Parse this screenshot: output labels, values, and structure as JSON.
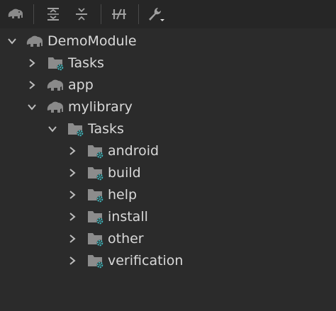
{
  "toolbar": {
    "buttons": [
      {
        "name": "elephant-icon",
        "label": "Gradle"
      },
      {
        "name": "expand-all-icon",
        "label": "Expand All"
      },
      {
        "name": "collapse-all-icon",
        "label": "Collapse All"
      },
      {
        "name": "toggle-offline-icon",
        "label": "Toggle Offline Mode"
      },
      {
        "name": "wrench-dropdown-icon",
        "label": "Build Tool Settings"
      }
    ]
  },
  "tree": {
    "items": [
      {
        "label": "DemoModule",
        "icon": "elephant-icon",
        "expanded": true,
        "level": 0
      },
      {
        "label": "Tasks",
        "icon": "task-folder-icon",
        "expanded": false,
        "level": 1
      },
      {
        "label": "app",
        "icon": "elephant-icon",
        "expanded": false,
        "level": 1
      },
      {
        "label": "mylibrary",
        "icon": "elephant-icon",
        "expanded": true,
        "level": 1
      },
      {
        "label": "Tasks",
        "icon": "task-folder-icon",
        "expanded": true,
        "level": 2
      },
      {
        "label": "android",
        "icon": "task-folder-icon",
        "expanded": false,
        "level": 3
      },
      {
        "label": "build",
        "icon": "task-folder-icon",
        "expanded": false,
        "level": 3
      },
      {
        "label": "help",
        "icon": "task-folder-icon",
        "expanded": false,
        "level": 3
      },
      {
        "label": "install",
        "icon": "task-folder-icon",
        "expanded": false,
        "level": 3
      },
      {
        "label": "other",
        "icon": "task-folder-icon",
        "expanded": false,
        "level": 3
      },
      {
        "label": "verification",
        "icon": "task-folder-icon",
        "expanded": false,
        "level": 3
      }
    ]
  },
  "colors": {
    "background": "#2b2b2b",
    "toolbar": "#262626",
    "text": "#d9d9d9",
    "icon_gray": "#8a8a8a",
    "folder": "#8c8c8c",
    "gear": "#3fb0b5"
  }
}
